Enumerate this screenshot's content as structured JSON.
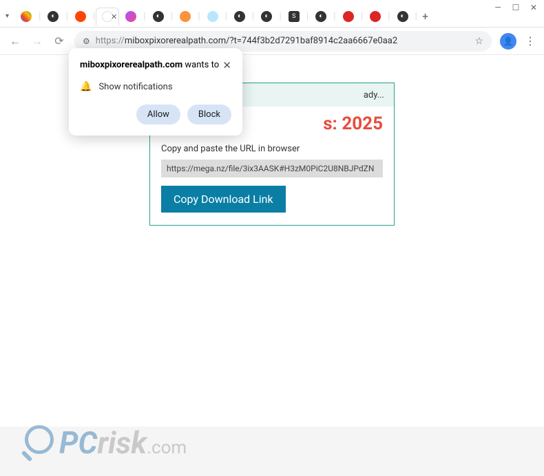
{
  "window": {
    "minimize": "—",
    "maximize": "☐",
    "close": "✕"
  },
  "tabs": {
    "new": "+"
  },
  "nav": {
    "back": "←",
    "forward": "→",
    "reload": "⟳"
  },
  "address": {
    "site_icon": "⚙",
    "prefix": "https://",
    "url": "miboxpixorerealpath.com/?t=744f3b2d7291baf8914c2aa6667e0aa2",
    "star": "☆",
    "menu": "⋮"
  },
  "popup": {
    "domain": "miboxpixorerealpath.com",
    "wants": " wants to",
    "close": "✕",
    "bell": "🔔",
    "item": "Show notifications",
    "allow": "Allow",
    "block": "Block"
  },
  "card": {
    "header_tail": "ady...",
    "stat": "s: 2025",
    "hint": "Copy and paste the URL in browser",
    "link": "https://mega.nz/file/3ix3AASK#H3zM0PiC2U8NBJPdZN",
    "button": "Copy Download Link"
  },
  "watermark": {
    "pc": "PC",
    "risk": "risk",
    "com": ".com"
  }
}
